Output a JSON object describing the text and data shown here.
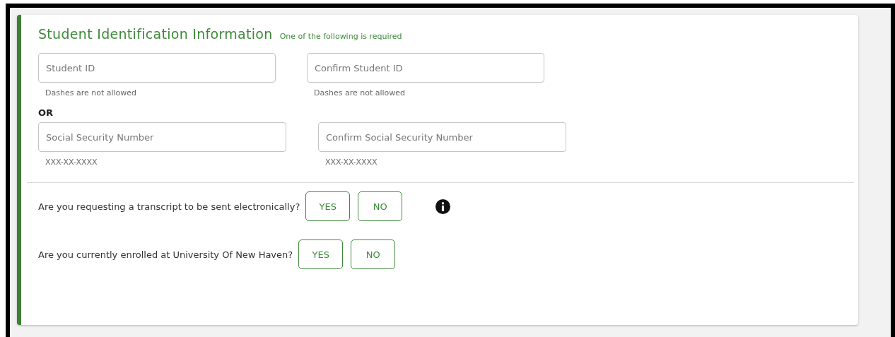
{
  "section": {
    "title": "Student Identification Information",
    "note": "One of the following is required"
  },
  "student_id_fields": [
    {
      "placeholder": "Student ID",
      "hint": "Dashes are not allowed"
    },
    {
      "placeholder": "Confirm Student ID",
      "hint": "Dashes are not allowed"
    }
  ],
  "separator": "OR",
  "ssn_fields": [
    {
      "placeholder": "Social Security Number",
      "hint": "XXX-XX-XXXX"
    },
    {
      "placeholder": "Confirm Social Security Number",
      "hint": "XXX-XX-XXXX"
    }
  ],
  "questions": [
    {
      "text": "Are you requesting a transcript to be sent electronically?",
      "info": true,
      "options": [
        {
          "label": "YES",
          "selected": false
        },
        {
          "label": "NO",
          "selected": false
        }
      ]
    },
    {
      "text": "Are you currently enrolled at University Of New Haven?",
      "info": false,
      "options": [
        {
          "label": "YES",
          "selected": false
        },
        {
          "label": "NO",
          "selected": false
        }
      ]
    }
  ]
}
